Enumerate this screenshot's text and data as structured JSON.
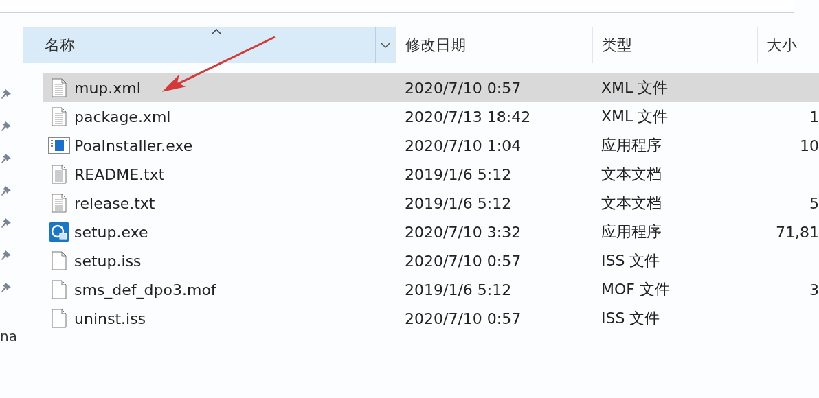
{
  "sidebar": {
    "items": [
      {
        "pinned": true
      },
      {
        "pinned": true
      },
      {
        "pinned": true
      },
      {
        "pinned": true
      },
      {
        "pinned": true
      },
      {
        "pinned": true
      },
      {
        "pinned": true
      },
      {
        "pinned": false,
        "label": "na"
      }
    ]
  },
  "table": {
    "columns": [
      {
        "label": "名称",
        "selected": true,
        "sorted": true
      },
      {
        "label": "修改日期",
        "selected": false
      },
      {
        "label": "类型",
        "selected": false
      },
      {
        "label": "大小",
        "selected": false
      }
    ],
    "rows": [
      {
        "name": "mup.xml",
        "kind": "text",
        "date": "2020/7/10 0:57",
        "type": "XML 文件",
        "size": "",
        "selected": true
      },
      {
        "name": "package.xml",
        "kind": "text",
        "date": "2020/7/13 18:42",
        "type": "XML 文件",
        "size": "1",
        "selected": false
      },
      {
        "name": "PoaInstaller.exe",
        "kind": "app",
        "date": "2020/7/10 1:04",
        "type": "应用程序",
        "size": "10",
        "selected": false
      },
      {
        "name": "README.txt",
        "kind": "text",
        "date": "2019/1/6 5:12",
        "type": "文本文档",
        "size": "",
        "selected": false
      },
      {
        "name": "release.txt",
        "kind": "text",
        "date": "2019/1/6 5:12",
        "type": "文本文档",
        "size": "5",
        "selected": false
      },
      {
        "name": "setup.exe",
        "kind": "setup",
        "date": "2020/7/10 3:32",
        "type": "应用程序",
        "size": "71,81",
        "selected": false
      },
      {
        "name": "setup.iss",
        "kind": "plain",
        "date": "2020/7/10 0:57",
        "type": "ISS 文件",
        "size": "",
        "selected": false
      },
      {
        "name": "sms_def_dpo3.mof",
        "kind": "plain",
        "date": "2019/1/6 5:12",
        "type": "MOF 文件",
        "size": "3",
        "selected": false
      },
      {
        "name": "uninst.iss",
        "kind": "plain",
        "date": "2020/7/10 0:57",
        "type": "ISS 文件",
        "size": "",
        "selected": false
      }
    ]
  },
  "annotation": {
    "kind": "arrow",
    "color": "#d23a3a"
  }
}
